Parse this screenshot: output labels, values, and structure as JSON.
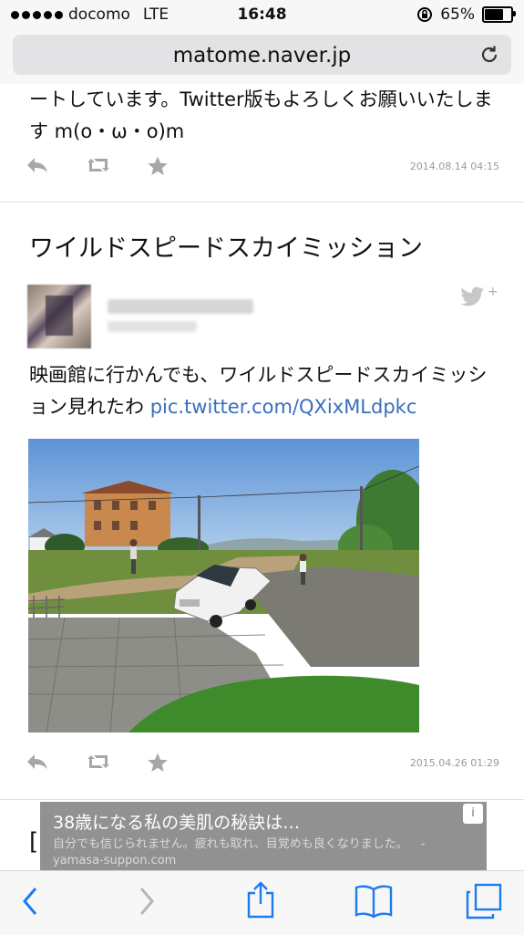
{
  "status_bar": {
    "carrier": "docomo",
    "network": "LTE",
    "time": "16:48",
    "battery": "65%",
    "battery_level": 0.65
  },
  "browser": {
    "url": "matome.naver.jp"
  },
  "prev_tweet": {
    "text": "ートしています。Twitter版もよろしくお願いいたします m(o・ω・o)m",
    "timestamp": "2014.08.14 04:15"
  },
  "section": {
    "heading": "ワイルドスピードスカイミッション"
  },
  "tweet": {
    "plus": "+",
    "text": "映画館に行かんでも、ワイルドスピードスカイミッション見れたわ",
    "link": "pic.twitter.com/QXixMLdpkc",
    "timestamp": "2015.04.26 01:29"
  },
  "next": {
    "heading_fragment": "["
  },
  "ad": {
    "title": "38歳になる私の美肌の秘訣は…",
    "desc": "自分でも信じられません。疲れも取れ、目覚めも良くなりました。",
    "source": "- yamasa-suppon.com",
    "info": "i"
  },
  "colors": {
    "link": "#3a6dbe",
    "ios_blue": "#1d7bf0",
    "icon_gray": "#a7a7a7"
  }
}
